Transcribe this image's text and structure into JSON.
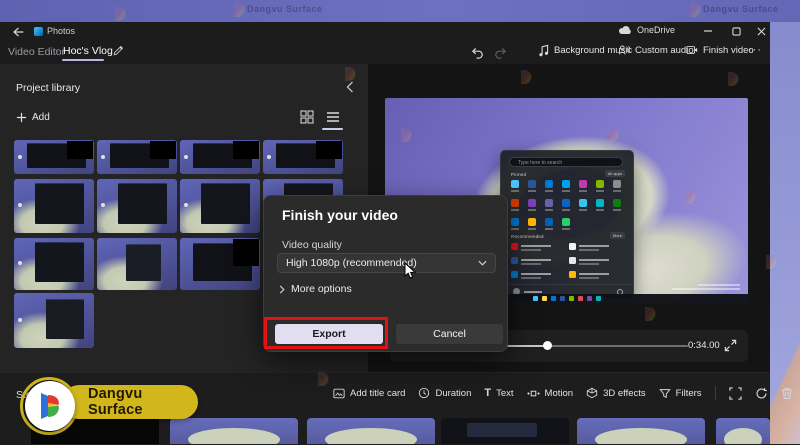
{
  "window": {
    "title": "Photos",
    "onedrive": "OneDrive"
  },
  "breadcrumb": {
    "section": "Video Editor",
    "project": "Hoc's Vlog"
  },
  "toolbar": {
    "background_music": "Background music",
    "custom_audio": "Custom audio",
    "finish_video": "Finish video"
  },
  "project_library": {
    "title": "Project library",
    "add": "Add"
  },
  "dialog": {
    "title": "Finish your video",
    "video_quality_label": "Video quality",
    "video_quality_value": "High 1080p (recommended)",
    "more_options": "More options",
    "export": "Export",
    "cancel": "Cancel"
  },
  "player": {
    "time": "0:34.00"
  },
  "storyboard": {
    "label": "Storyboard"
  },
  "bottom_toolbar": {
    "add_title_card": "Add title card",
    "duration": "Duration",
    "text": "Text",
    "motion": "Motion",
    "effects_3d": "3D effects",
    "filters": "Filters"
  },
  "watermark": {
    "brand": "Dangvu Surface"
  },
  "preview_start_menu": {
    "search": "Type here to search",
    "pinned": "Pinned",
    "all_apps": "All apps",
    "recommended": "Recommended",
    "more": "More"
  },
  "colors": {
    "annotation_red": "#e01312",
    "brand_yellow": "#d2b71c",
    "desktop_purple": "#6568b8",
    "export_button": "#e2ddf1"
  },
  "decor": {
    "start_menu_icons": [
      "#4cc2ff",
      "#2b579a",
      "#0078d4",
      "#00a2ed",
      "#c239b3",
      "#7fba00",
      "#8d8d8d",
      "#d83b01",
      "#7b42bc",
      "#6264a7",
      "#0a66c2",
      "#36c5f0",
      "#00b7c3",
      "#107c10",
      "#0078d4",
      "#ffb900",
      "#0063b1",
      "#25d366"
    ],
    "taskbar_icons": [
      "#4cc2ff",
      "#ffd84d",
      "#0078d4",
      "#2b579a",
      "#7fba00",
      "#e74856",
      "#744da9",
      "#00b7c3"
    ],
    "recommended_icons": [
      "#e81123",
      "#f3f3f3",
      "#2b579a",
      "#e8e8e8",
      "#0078d4",
      "#ffb900"
    ]
  }
}
